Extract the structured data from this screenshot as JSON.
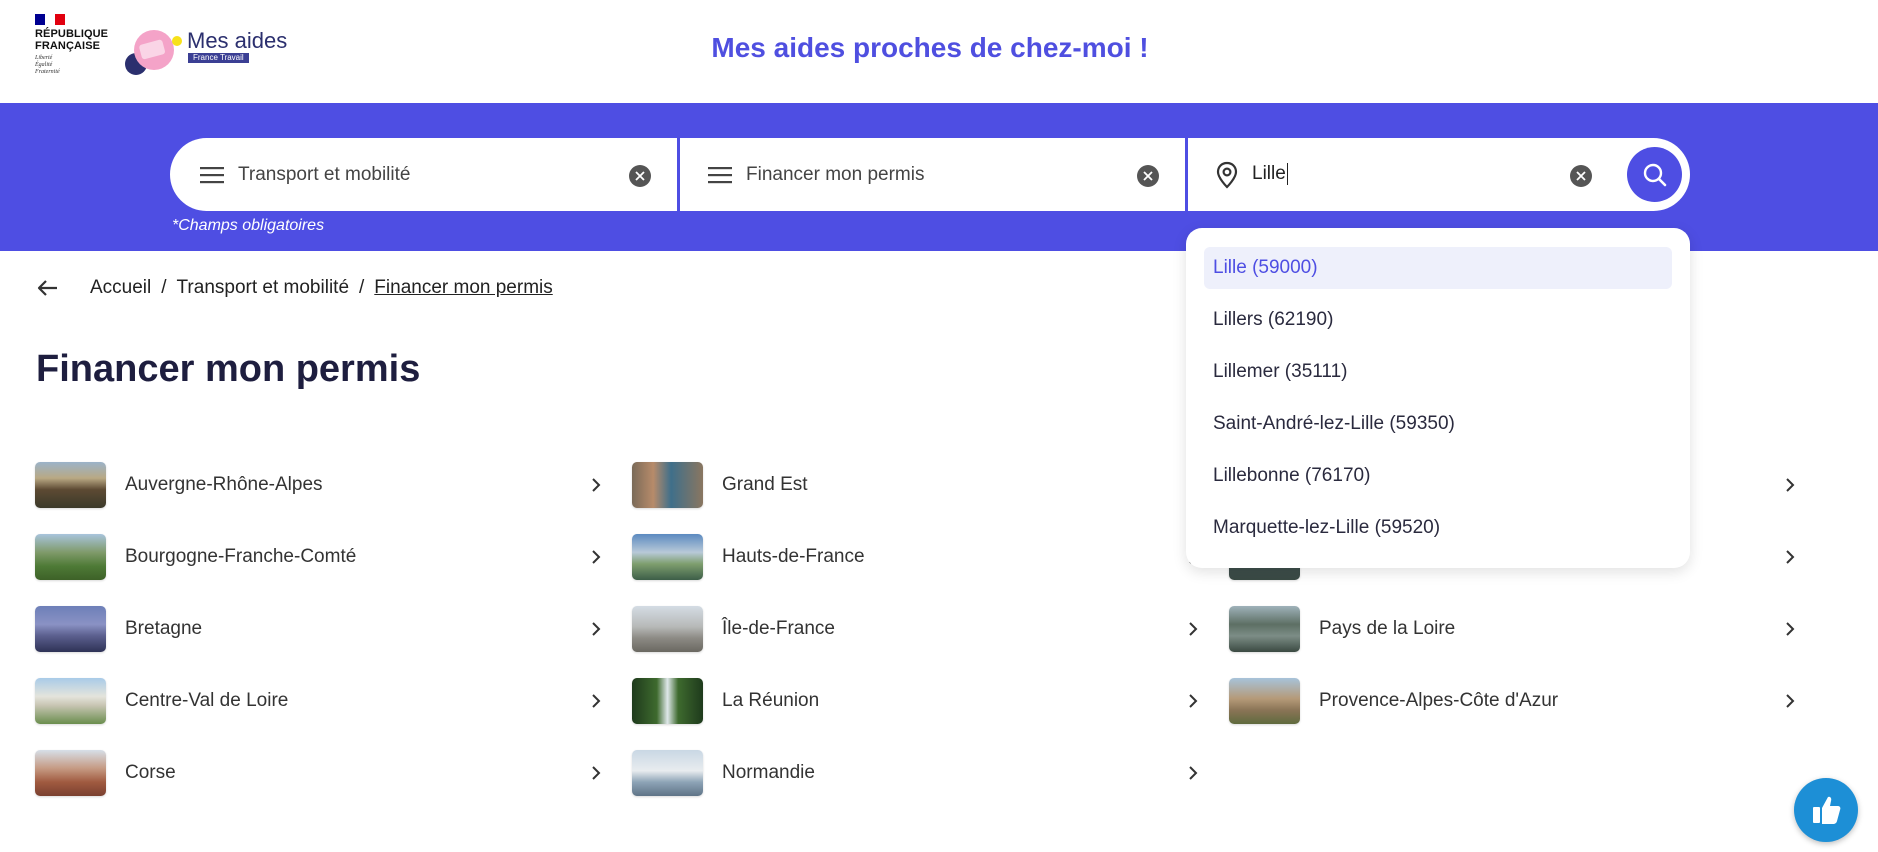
{
  "header": {
    "republique_line1": "RÉPUBLIQUE",
    "republique_line2": "FRANÇAISE",
    "motto_1": "Liberté",
    "motto_2": "Égalité",
    "motto_3": "Fraternité",
    "app_name": "Mes aides",
    "app_sub": "France Travail",
    "site_title": "Mes aides proches de chez-moi !"
  },
  "search": {
    "category": "Transport et mobilité",
    "need": "Financer mon permis",
    "location": "Lille",
    "required_note": "*Champs obligatoires"
  },
  "suggestions": [
    "Lille (59000)",
    "Lillers (62190)",
    "Lillemer (35111)",
    "Saint-André-lez-Lille (59350)",
    "Lillebonne (76170)",
    "Marquette-lez-Lille (59520)"
  ],
  "breadcrumb": {
    "home": "Accueil",
    "sep": "/",
    "category": "Transport et mobilité",
    "current": "Financer mon permis"
  },
  "page_title": "Financer mon permis",
  "regions": [
    "Auvergne-Rhône-Alpes",
    "Grand Est",
    "Bourgogne-Franche-Comté",
    "Hauts-de-France",
    "Bretagne",
    "Île-de-France",
    "Pays de la Loire",
    "Centre-Val de Loire",
    "La Réunion",
    "Provence-Alpes-Côte d'Azur",
    "Corse",
    "Normandie"
  ],
  "colors": {
    "brand": "#4e4ee3",
    "fab": "#1d8fd6"
  }
}
